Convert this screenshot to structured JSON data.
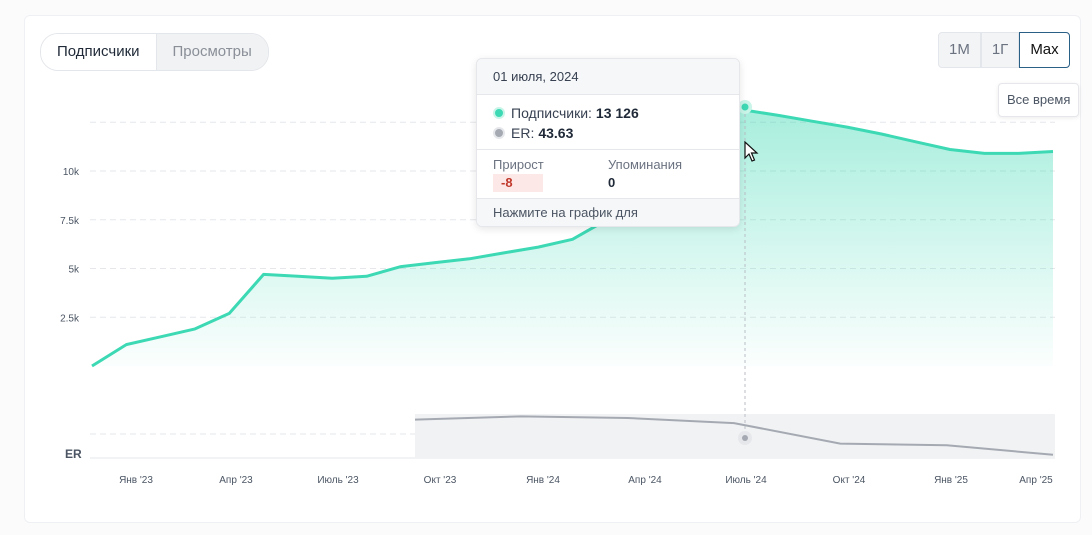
{
  "tabs": {
    "subscribers": "Подписчики",
    "views": "Просмотры"
  },
  "ranges": {
    "m1": "1М",
    "y1": "1Г",
    "max": "Max",
    "max_tooltip": "Все время"
  },
  "tooltip": {
    "date": "01 июля, 2024",
    "subs_label": "Подписчики:",
    "subs_value": "13 126",
    "er_label": "ER:",
    "er_value": "43.63",
    "growth_label": "Прирост",
    "growth_value": "-8",
    "mentions_label": "Упоминания",
    "mentions_value": "0",
    "footer": "Нажмите на график для подробностей"
  },
  "colors": {
    "subscribers": "#3dd9b4",
    "er": "#a5aab2",
    "accent": "#2a5f86"
  },
  "chart_data": {
    "type": "area",
    "title": "",
    "xlabel": "",
    "ylabel": "",
    "ylim": [
      0,
      13500
    ],
    "yticks": [
      "2.5k",
      "5k",
      "7.5k",
      "10k"
    ],
    "er_axis_label": "ER",
    "xticks": [
      "Янв '23",
      "Апр '23",
      "Июль '23",
      "Окт '23",
      "Янв '24",
      "Апр '24",
      "Июль '24",
      "Окт '24",
      "Янв '25",
      "Апр '25"
    ],
    "series": [
      {
        "name": "Подписчики",
        "x": [
          "Дек '22",
          "Янв '23",
          "Фев '23",
          "Мар '23",
          "Апр '23",
          "Май '23",
          "Июнь '23",
          "Июль '23",
          "Авг '23",
          "Сен '23",
          "Окт '23",
          "Ноя '23",
          "Дек '23",
          "Янв '24",
          "Фев '24",
          "Мар '24",
          "Апр '24",
          "Май '24",
          "Июнь '24",
          "Июль '24",
          "Авг '24",
          "Сен '24",
          "Окт '24",
          "Ноя '24",
          "Дек '24",
          "Янв '25",
          "Фев '25",
          "Мар '25",
          "Апр '25"
        ],
        "values": [
          0,
          1100,
          1500,
          1900,
          2700,
          4700,
          4600,
          4500,
          4600,
          5100,
          5300,
          5500,
          5800,
          6100,
          6500,
          7500,
          8300,
          11800,
          13100,
          13126,
          12850,
          12550,
          12250,
          11900,
          11500,
          11100,
          10900,
          10900,
          11000
        ]
      },
      {
        "name": "ER",
        "x": [
          "Окт '23",
          "Янв '24",
          "Апр '24",
          "Июль '24",
          "Окт '24",
          "Янв '25",
          "Апр '25"
        ],
        "values": [
          48,
          52,
          50,
          43.63,
          18,
          16,
          4
        ]
      }
    ],
    "grid": true,
    "legend": "none"
  }
}
